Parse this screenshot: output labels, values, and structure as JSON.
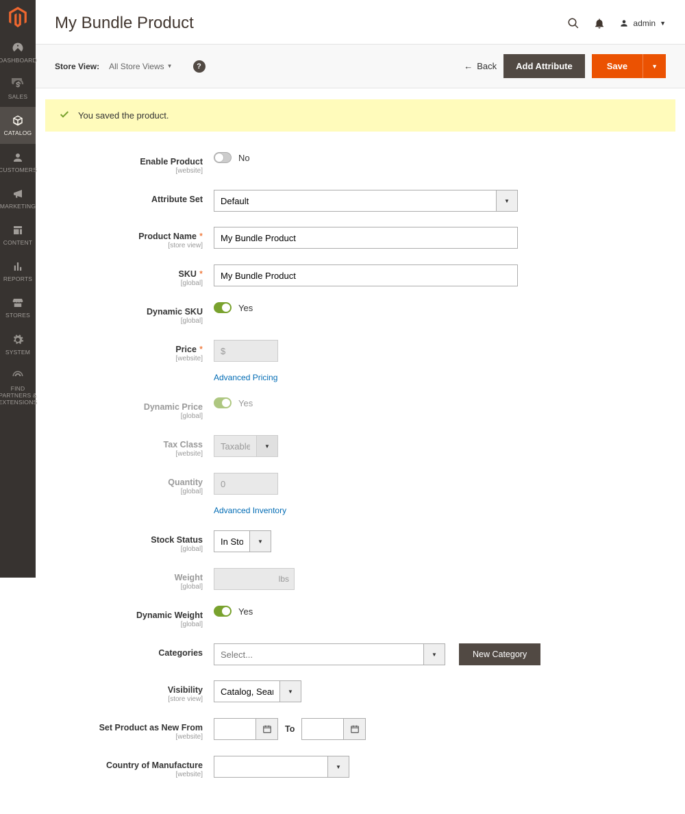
{
  "header": {
    "title": "My Bundle Product",
    "user": "admin"
  },
  "sidebar": {
    "items": [
      {
        "label": "DASHBOARD"
      },
      {
        "label": "SALES"
      },
      {
        "label": "CATALOG"
      },
      {
        "label": "CUSTOMERS"
      },
      {
        "label": "MARKETING"
      },
      {
        "label": "CONTENT"
      },
      {
        "label": "REPORTS"
      },
      {
        "label": "STORES"
      },
      {
        "label": "SYSTEM"
      },
      {
        "label": "FIND PARTNERS & EXTENSIONS"
      }
    ]
  },
  "toolbar": {
    "store_view_label": "Store View:",
    "store_view_value": "All Store Views",
    "back_label": "Back",
    "add_attribute_label": "Add Attribute",
    "save_label": "Save"
  },
  "message": {
    "text": "You saved the product."
  },
  "form": {
    "enable_product": {
      "label": "Enable Product",
      "scope": "[website]",
      "value": "No"
    },
    "attribute_set": {
      "label": "Attribute Set",
      "value": "Default"
    },
    "product_name": {
      "label": "Product Name",
      "scope": "[store view]",
      "value": "My Bundle Product"
    },
    "sku": {
      "label": "SKU",
      "scope": "[global]",
      "value": "My Bundle Product"
    },
    "dynamic_sku": {
      "label": "Dynamic SKU",
      "scope": "[global]",
      "value": "Yes"
    },
    "price": {
      "label": "Price",
      "scope": "[website]",
      "value": "$",
      "link": "Advanced Pricing"
    },
    "dynamic_price": {
      "label": "Dynamic Price",
      "scope": "[global]",
      "value": "Yes"
    },
    "tax_class": {
      "label": "Tax Class",
      "scope": "[website]",
      "value": "Taxable Goods"
    },
    "quantity": {
      "label": "Quantity",
      "scope": "[global]",
      "value": "0",
      "link": "Advanced Inventory"
    },
    "stock_status": {
      "label": "Stock Status",
      "scope": "[global]",
      "value": "In Stock"
    },
    "weight": {
      "label": "Weight",
      "scope": "[global]",
      "value": "",
      "unit": "lbs"
    },
    "dynamic_weight": {
      "label": "Dynamic Weight",
      "scope": "[global]",
      "value": "Yes"
    },
    "categories": {
      "label": "Categories",
      "placeholder": "Select...",
      "new_btn": "New Category"
    },
    "visibility": {
      "label": "Visibility",
      "scope": "[store view]",
      "value": "Catalog, Search"
    },
    "set_new": {
      "label": "Set Product as New From",
      "scope": "[website]",
      "to": "To"
    },
    "country": {
      "label": "Country of Manufacture",
      "scope": "[website]",
      "value": ""
    }
  }
}
